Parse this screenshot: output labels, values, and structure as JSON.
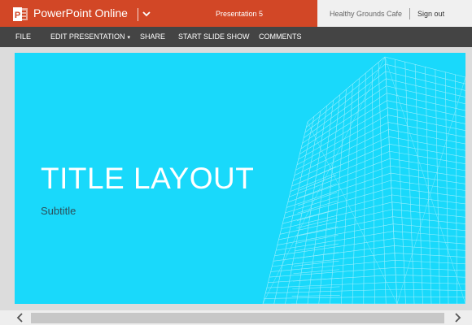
{
  "app": {
    "name": "PowerPoint Online",
    "document_title": "Presentation 5",
    "user_name": "Healthy Grounds Cafe",
    "sign_out_label": "Sign out",
    "colors": {
      "titlebar": "#d24726",
      "menubar": "#444444",
      "slide_background": "#19d9fb"
    }
  },
  "menu": {
    "items": [
      {
        "label": "FILE"
      },
      {
        "label": "EDIT PRESENTATION"
      },
      {
        "label": "SHARE"
      },
      {
        "label": "START SLIDE SHOW"
      },
      {
        "label": "COMMENTS"
      }
    ]
  },
  "slide": {
    "title": "TITLE LAYOUT",
    "subtitle": "Subtitle"
  },
  "icons": {
    "logo": "powerpoint-logo-icon",
    "app_menu": "chevron-down-icon",
    "scroll_left": "chevron-left-icon",
    "scroll_right": "chevron-right-icon"
  }
}
